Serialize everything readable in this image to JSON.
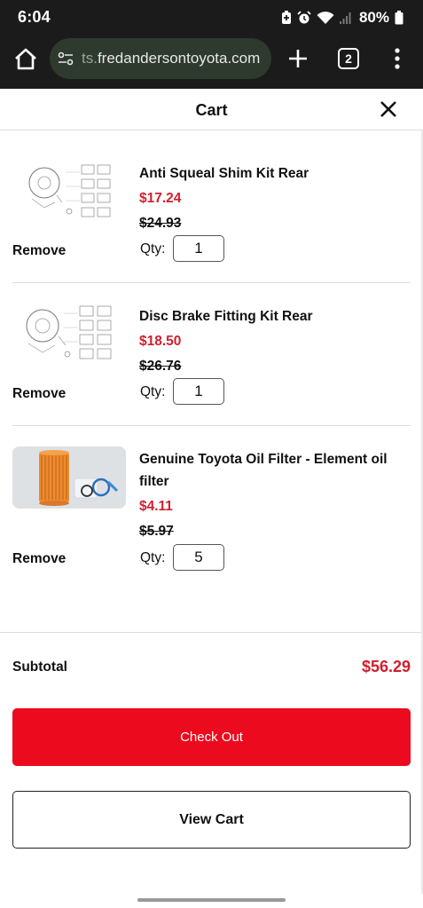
{
  "status_bar": {
    "time": "6:04",
    "battery": "80%"
  },
  "browser": {
    "url_prefix": "ts.",
    "url_rest": "fredandersontoyota.com",
    "tab_count": "2"
  },
  "cart": {
    "title": "Cart"
  },
  "items": [
    {
      "name": "Anti Squeal Shim Kit Rear",
      "price": "$17.24",
      "old_price": "$24.93",
      "remove_label": "Remove",
      "qty_label": "Qty:",
      "qty": "1",
      "thumb": "parts-diagram"
    },
    {
      "name": "Disc Brake Fitting Kit Rear",
      "price": "$18.50",
      "old_price": "$26.76",
      "remove_label": "Remove",
      "qty_label": "Qty:",
      "qty": "1",
      "thumb": "parts-diagram"
    },
    {
      "name": "Genuine Toyota Oil Filter - Element oil filter",
      "price": "$4.11",
      "old_price": "$5.97",
      "remove_label": "Remove",
      "qty_label": "Qty:",
      "qty": "5",
      "thumb": "oil-filter-photo"
    }
  ],
  "summary": {
    "subtotal_label": "Subtotal",
    "subtotal_value": "$56.29"
  },
  "actions": {
    "checkout_label": "Check Out",
    "view_cart_label": "View Cart"
  },
  "colors": {
    "accent_red": "#eb0a1e",
    "price_red": "#d0202e",
    "browser_dark": "#1b1b1b"
  }
}
